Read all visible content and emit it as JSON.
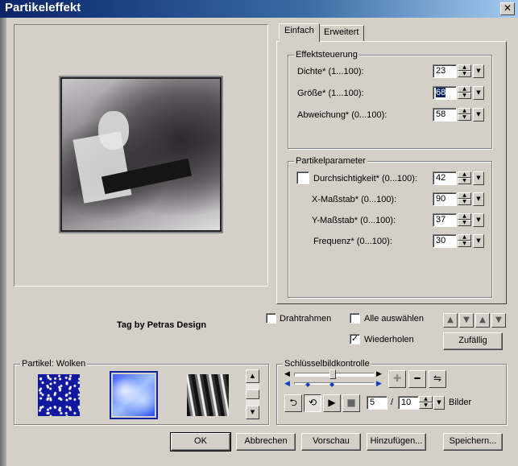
{
  "window": {
    "title": "Partikeleffekt",
    "close_glyph": "✕"
  },
  "preview": {
    "caption": "Tag by Petras Design"
  },
  "tabs": [
    {
      "label": "Einfach",
      "active": true
    },
    {
      "label": "Erweitert",
      "active": false
    }
  ],
  "effect_group": {
    "label": "Effektsteuerung",
    "rows": [
      {
        "label": "Dichte* (1...100):",
        "value": "23"
      },
      {
        "label": "Größe* (1...100):",
        "value": "68",
        "selected": true
      },
      {
        "label": "Abweichung* (0...100):",
        "value": "58"
      }
    ]
  },
  "particle_group": {
    "label": "Partikelparameter",
    "rows": [
      {
        "label": "Durchsichtigkeit* (0...100):",
        "value": "42",
        "checkbox": true,
        "checked": false
      },
      {
        "label": "X-Maßstab* (0...100):",
        "value": "90"
      },
      {
        "label": "Y-Maßstab* (0...100):",
        "value": "37"
      },
      {
        "label": "Frequenz* (0...100):",
        "value": "30"
      }
    ]
  },
  "options": {
    "wireframe": {
      "label": "Drahtrahmen",
      "checked": false
    },
    "select_all": {
      "label": "Alle auswählen",
      "checked": false
    },
    "repeat": {
      "label": "Wiederholen",
      "checked": true
    },
    "random_button": "Zufällig"
  },
  "particles": {
    "label": "Partikel: Wolken",
    "thumbnails": [
      {
        "name": "stars",
        "selected": false
      },
      {
        "name": "clouds",
        "selected": true
      },
      {
        "name": "smoke",
        "selected": false
      }
    ]
  },
  "keyframes": {
    "label": "Schlüsselbildkontrolle",
    "frame": "5",
    "separator": "/",
    "total": "10",
    "unit": "Bilder"
  },
  "footer_buttons": {
    "ok": "OK",
    "cancel": "Abbrechen",
    "preview": "Vorschau",
    "add": "Hinzufügen...",
    "save": "Speichern..."
  },
  "glyphs": {
    "up": "▲",
    "down": "▼",
    "check": "✓"
  }
}
